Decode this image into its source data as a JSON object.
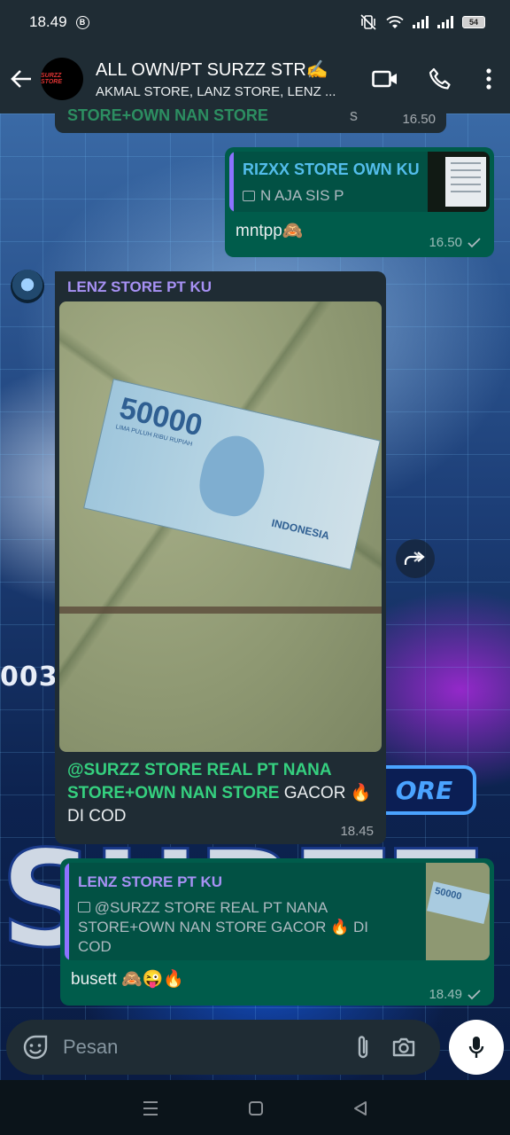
{
  "status_bar": {
    "time": "18.49",
    "badge": "B",
    "battery": "54"
  },
  "header": {
    "title": "ALL OWN/PT SURZZ STR✍️",
    "subtitle": "AKMAL STORE, LANZ STORE, LENZ ...",
    "avatar_text": "SURZZ STORE"
  },
  "wallpaper": {
    "code_text": "0034",
    "ore_text": "ORE",
    "big_text": "SURZZ"
  },
  "messages": [
    {
      "type": "incoming-cut",
      "text_mention": "STORE+OWN NAN STORE",
      "text_tail": "s",
      "time": "16.50"
    },
    {
      "type": "outgoing",
      "quote_name": "RIZXX STORE OWN KU",
      "quote_text": "N AJA SIS P",
      "text": "mntpp🙈",
      "time": "16.50"
    },
    {
      "type": "incoming-image",
      "sender": "LENZ STORE PT KU",
      "note_value": "50000",
      "note_words": "LIMA PULUH RIBU RUPIAH",
      "note_country": "INDONESIA",
      "caption_mention": "@SURZZ STORE REAL PT NANA STORE+OWN NAN STORE",
      "caption_text": "  GACOR 🔥 DI COD",
      "time": "18.45"
    },
    {
      "type": "outgoing",
      "quote_name": "LENZ STORE PT KU",
      "quote_text": "@SURZZ STORE REAL PT NANA STORE+OWN NAN STORE   GACOR 🔥 DI COD",
      "thumb_value": "50000",
      "text": "busett 🙈😜🔥",
      "time": "18.49"
    }
  ],
  "input": {
    "placeholder": "Pesan"
  },
  "colors": {
    "header_bg": "#1f2c34",
    "incoming_bubble": "#1f2c34",
    "outgoing_bubble": "#005c4b",
    "mention_green": "#35d07f",
    "sender_purple": "#a791f4"
  }
}
